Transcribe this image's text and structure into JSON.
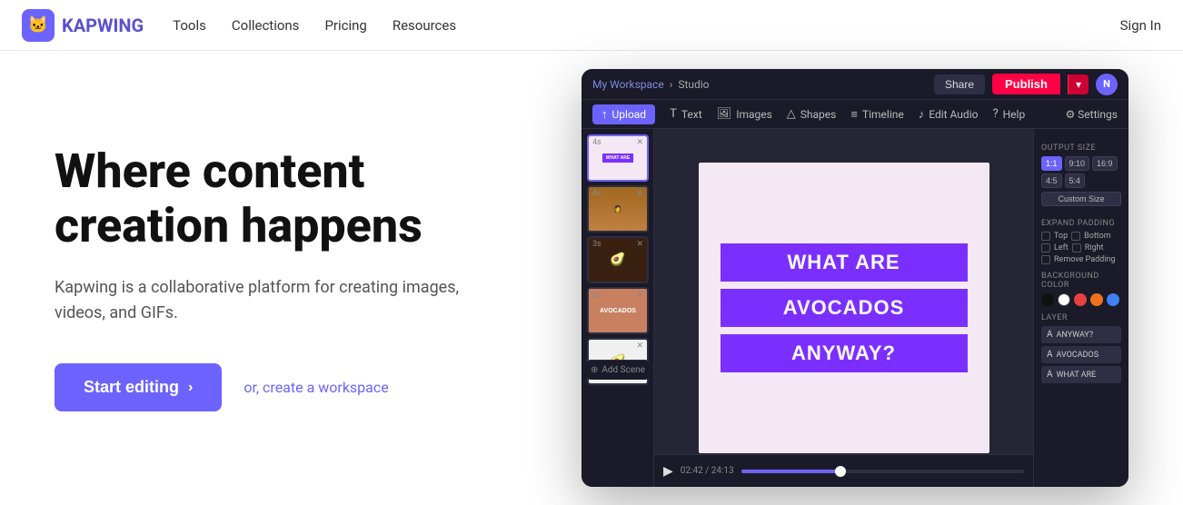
{
  "nav": {
    "logo_text": "KAPWING",
    "logo_emoji": "🐱",
    "links": [
      "Tools",
      "Collections",
      "Pricing",
      "Resources"
    ],
    "signin": "Sign In"
  },
  "hero": {
    "title_line1": "Where content",
    "title_line2": "creation happens",
    "subtitle": "Kapwing is a collaborative platform for creating images, videos, and GIFs.",
    "btn_start": "Start editing",
    "btn_chevron": "›",
    "link_text": "or, create a workspace"
  },
  "studio": {
    "breadcrumb_workspace": "My Workspace",
    "breadcrumb_sep": "›",
    "breadcrumb_studio": "Studio",
    "share_label": "Share",
    "publish_label": "Publish",
    "avatar_initial": "N",
    "tools": [
      "Upload",
      "Text",
      "Images",
      "Shapes",
      "Timeline",
      "Edit Audio",
      "Help"
    ],
    "settings_label": "⚙ Settings",
    "canvas_lines": [
      "WHAT ARE",
      "AVOCADOS",
      "ANYWAY?"
    ],
    "timeline_time": "02:42 / 24:13",
    "output_sizes": [
      "1:1",
      "9:10",
      "16:9",
      "4:5",
      "5:4"
    ],
    "active_size": "1:1",
    "custom_size_label": "Custom Size",
    "padding_section": "EXPAND PADDING",
    "padding_options": [
      "Top",
      "Bottom",
      "Left",
      "Right"
    ],
    "remove_padding_label": "Remove Padding",
    "bg_color_label": "BACKGROUND COLOR",
    "bg_hex": "#f0b1f0",
    "layers_section": "LAYER",
    "layers": [
      "ANYWAY?",
      "AVOCADOS",
      "WHAT ARE"
    ],
    "add_scene_label": "Add Scene"
  }
}
